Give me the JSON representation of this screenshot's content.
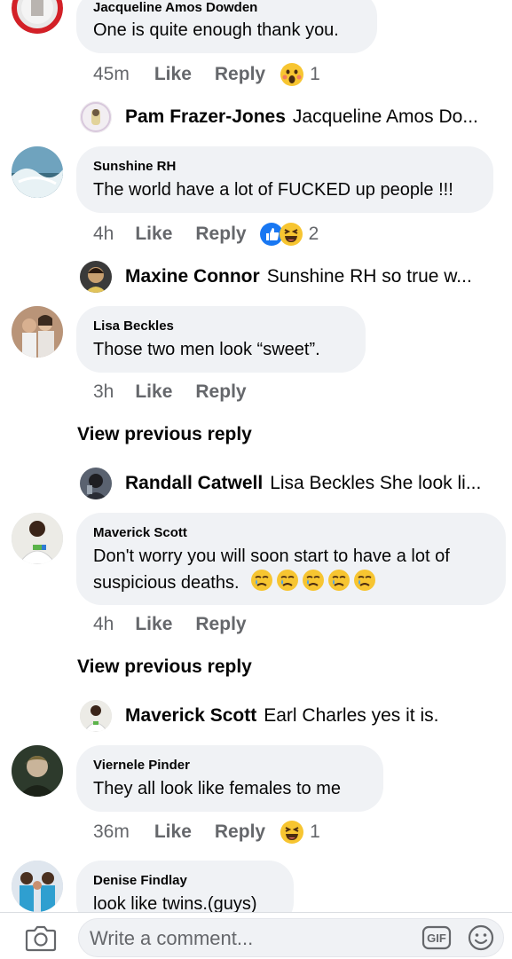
{
  "comments": [
    {
      "author": "Jacqueline Amos Dowden",
      "text": "One is quite enough thank you.",
      "time": "45m",
      "like": "Like",
      "reply": "Reply",
      "reactions": [
        "wow-face"
      ],
      "reaction_count": "1"
    },
    {
      "author": "Sunshine RH",
      "text": "The world have a lot of FUCKED up people !!!",
      "time": "4h",
      "like": "Like",
      "reply": "Reply",
      "reactions": [
        "like-thumb",
        "haha-face"
      ],
      "reaction_count": "2"
    },
    {
      "author": "Lisa Beckles",
      "text": "Those two men look “sweet”.",
      "time": "3h",
      "like": "Like",
      "reply": "Reply"
    },
    {
      "author": "Maverick Scott",
      "text_line1": "Don't worry you will soon start to have a lot of",
      "text_line2": "suspicious deaths.",
      "time": "4h",
      "like": "Like",
      "reply": "Reply"
    },
    {
      "author": "Viernele Pinder",
      "text": "They all look like females to me",
      "time": "36m",
      "like": "Like",
      "reply": "Reply",
      "reactions": [
        "haha-face"
      ],
      "reaction_count": "1"
    },
    {
      "author": "Denise Findlay",
      "text": "look like twins.(guys)"
    }
  ],
  "replies": [
    {
      "name": "Pam Frazer-Jones",
      "text": "Jacqueline Amos Do..."
    },
    {
      "name": "Maxine Connor",
      "text": "Sunshine   RH so true w..."
    },
    {
      "name": "Randall Catwell",
      "text": "Lisa Beckles She look li..."
    },
    {
      "name": "Maverick Scott",
      "text": "Earl Charles yes it is."
    }
  ],
  "view_previous": "View previous reply",
  "composer": {
    "placeholder": "Write a comment...",
    "gif_label": "GIF"
  },
  "colors": {
    "bubble": "#f0f2f5",
    "meta_text": "#65676b",
    "like_blue": "#1877f2",
    "emoji_yellow": "#f7c531"
  }
}
